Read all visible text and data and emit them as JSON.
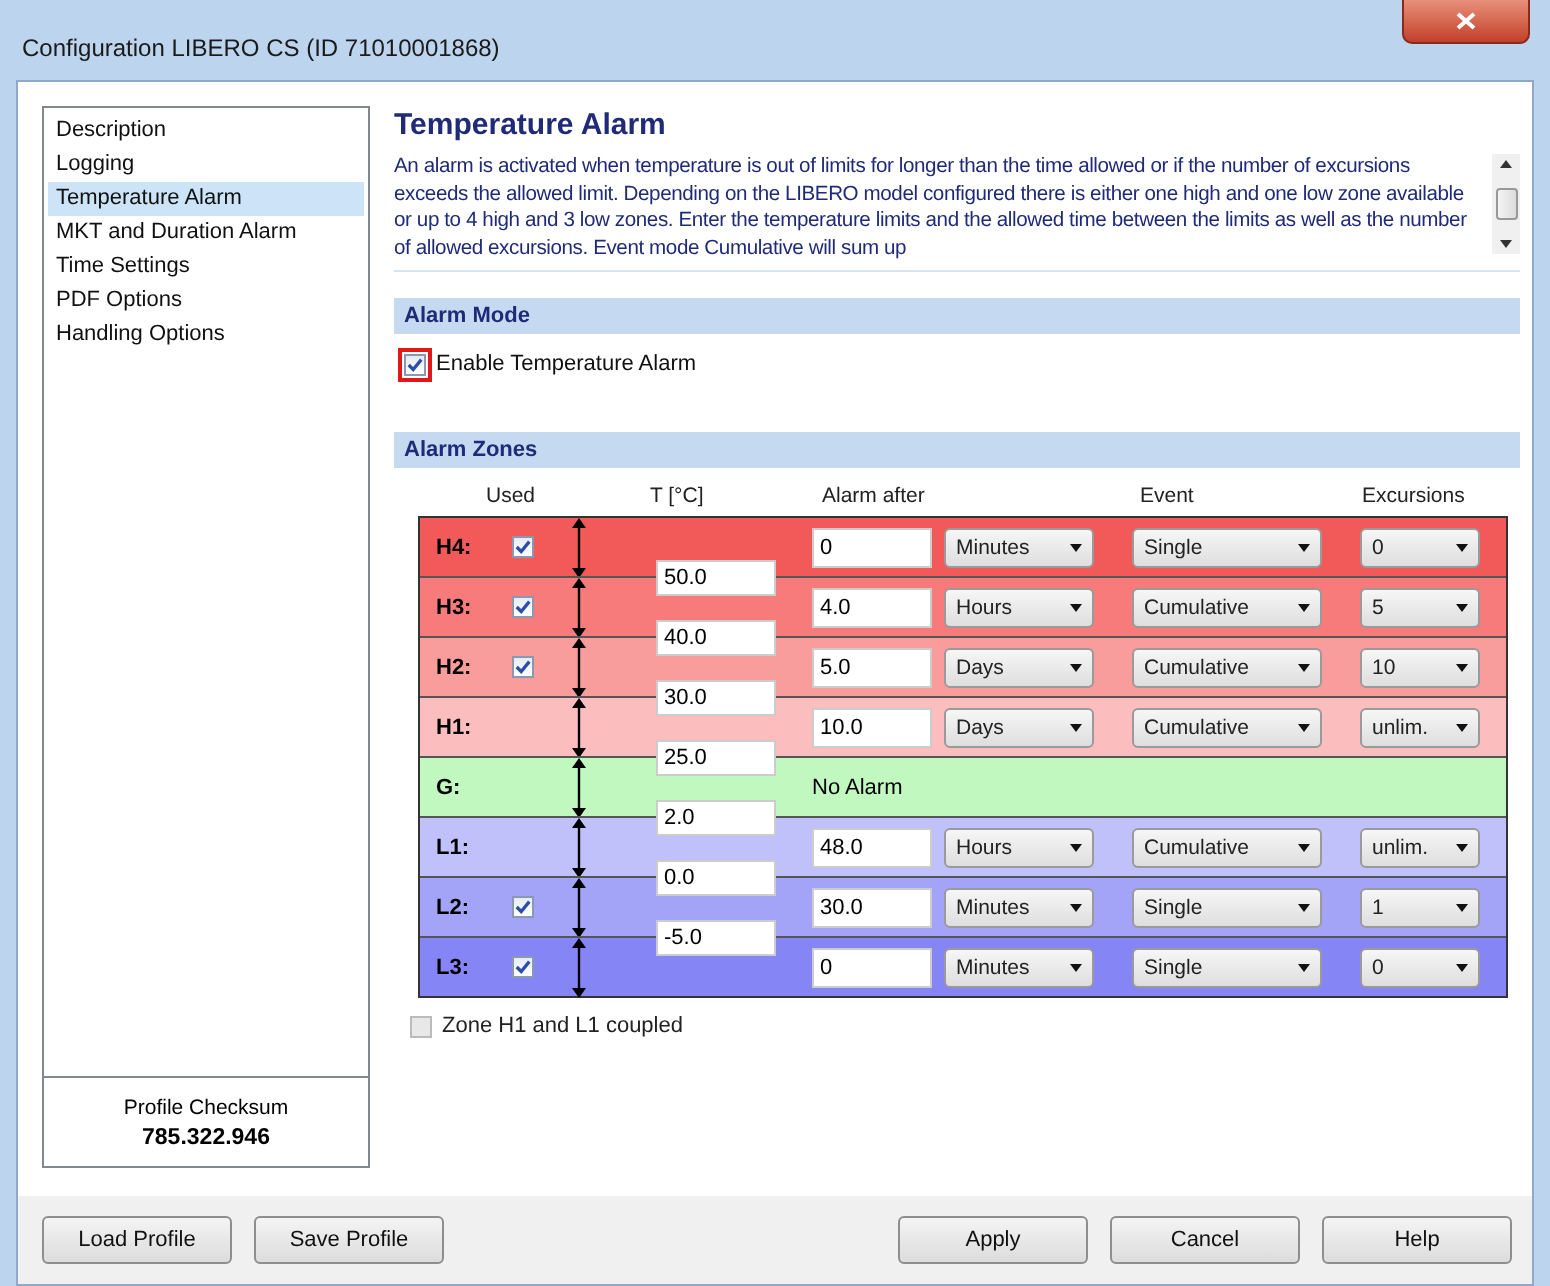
{
  "window": {
    "title": "Configuration LIBERO CS (ID 71010001868)"
  },
  "sidebar": {
    "items": [
      {
        "label": "Description",
        "selected": false
      },
      {
        "label": "Logging",
        "selected": false
      },
      {
        "label": "Temperature Alarm",
        "selected": true
      },
      {
        "label": "MKT and Duration Alarm",
        "selected": false
      },
      {
        "label": "Time Settings",
        "selected": false
      },
      {
        "label": "PDF Options",
        "selected": false
      },
      {
        "label": "Handling Options",
        "selected": false
      }
    ],
    "checksum_label": "Profile Checksum",
    "checksum_value": "785.322.946"
  },
  "page": {
    "title": "Temperature Alarm",
    "description": "An alarm is activated when temperature is out of limits for longer than the time allowed or if the number of excursions exceeds the allowed limit. Depending on the LIBERO model configured there is either one high and one low zone available or up to 4 high and 3 low zones. Enter the temperature limits and the allowed time between the limits as well as the number of allowed excursions. Event mode Cumulative will sum up"
  },
  "alarm_mode": {
    "heading": "Alarm Mode",
    "enable": {
      "label": "Enable Temperature Alarm",
      "checked": true
    }
  },
  "alarm_zones": {
    "heading": "Alarm Zones",
    "columns": [
      "Used",
      "T [°C]",
      "Alarm after",
      "Event",
      "Excursions"
    ],
    "zones": [
      {
        "kind": "alarm",
        "label": "H4:",
        "color": "#f25a5a",
        "used": true,
        "limit": "50.0",
        "alarm_after": "0",
        "unit": "Minutes",
        "event": "Single",
        "excursions": "0"
      },
      {
        "kind": "alarm",
        "label": "H3:",
        "color": "#f77b7b",
        "used": true,
        "limit": "40.0",
        "alarm_after": "4.0",
        "unit": "Hours",
        "event": "Cumulative",
        "excursions": "5"
      },
      {
        "kind": "alarm",
        "label": "H2:",
        "color": "#f99c9c",
        "used": true,
        "limit": "30.0",
        "alarm_after": "5.0",
        "unit": "Days",
        "event": "Cumulative",
        "excursions": "10"
      },
      {
        "kind": "alarm",
        "label": "H1:",
        "color": "#fbbdbd",
        "limit": "25.0",
        "alarm_after": "10.0",
        "unit": "Days",
        "event": "Cumulative",
        "excursions": "unlim."
      },
      {
        "kind": "no_alarm",
        "label": "G:",
        "color": "#c0f8c0",
        "limit": "2.0",
        "text": "No Alarm"
      },
      {
        "kind": "alarm",
        "label": "L1:",
        "color": "#c0c0fb",
        "limit": "0.0",
        "alarm_after": "48.0",
        "unit": "Hours",
        "event": "Cumulative",
        "excursions": "unlim."
      },
      {
        "kind": "alarm",
        "label": "L2:",
        "color": "#a3a3f8",
        "used": true,
        "limit": "-5.0",
        "alarm_after": "30.0",
        "unit": "Minutes",
        "event": "Single",
        "excursions": "1"
      },
      {
        "kind": "alarm",
        "label": "L3:",
        "color": "#8585f5",
        "used": true,
        "alarm_after": "0",
        "unit": "Minutes",
        "event": "Single",
        "excursions": "0"
      }
    ],
    "coupled": {
      "label": "Zone H1 and L1 coupled",
      "checked": false
    }
  },
  "buttons_left": [
    "Load Profile",
    "Save Profile"
  ],
  "buttons_right": [
    "Apply",
    "Cancel",
    "Help"
  ]
}
